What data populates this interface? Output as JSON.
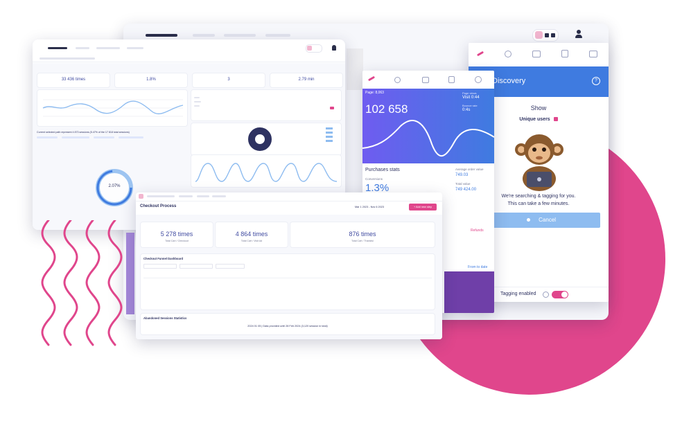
{
  "back_window": {
    "topbar_icons": [
      "avatar-icon",
      "toggle-icon",
      "user-icon"
    ]
  },
  "dashboard": {
    "stats": [
      {
        "value": "33 436 times",
        "sub": ""
      },
      {
        "value": "1.8%",
        "sub": ""
      },
      {
        "value": "3",
        "sub": ""
      },
      {
        "value": "2.79 min",
        "sub": ""
      }
    ],
    "segment_text": "Current selected path represent 4 873 sessions (5.47% of the 17 818 total sessions)",
    "donut_label": "2.07%"
  },
  "mobile": {
    "pages_label": "Page: 8,063",
    "big_value": "102 658",
    "side_label_1": "Page views",
    "side_value_1": "Visit 0:44",
    "side_label_2": "Bounce rate",
    "side_value_2": "0:4s",
    "purchases_title": "Purchases stats",
    "conversion_label": "Conversions",
    "conversion_value": "1.3%",
    "avg_order_label": "Average order value",
    "avg_order_value": "749.03",
    "total_label": "Total value",
    "total_value": "749 424.00",
    "refunds_label": "Refunds",
    "from_date_label": "From to date"
  },
  "discovery": {
    "title": "Discovery",
    "show_label": "Show",
    "unique_users_label": "Unique users",
    "message_line1": "We're searching & tagging for you.",
    "message_line2": "This can take a few minutes.",
    "cancel_label": "Cancel",
    "tagging_label": "Tagging enabled"
  },
  "checkout": {
    "title": "Checkout Process",
    "date_range": "Mar 1 2023 - Nov 6 2023",
    "add_button": "+ Add new step",
    "stats": [
      {
        "value": "5 278 times",
        "sub": "Total Cart / Checkout"
      },
      {
        "value": "4 864 times",
        "sub": "Total Cart / Visit Ad"
      },
      {
        "value": "876 times",
        "sub": "Total Cart / Thankful"
      }
    ],
    "funnel_title": "Checkout Funnel Dashboard",
    "sessions_title": "Abandoned Sessions Statistics",
    "footer_note": "2024 01 05 | Data provided until 28 Feb 2024 (3,120 session in total)"
  },
  "colors": {
    "accent_pink": "#e0468c",
    "blue": "#3f7be0",
    "purple": "#6f5cf0",
    "navy": "#2e3261",
    "light_blue": "#8ebcf0"
  }
}
